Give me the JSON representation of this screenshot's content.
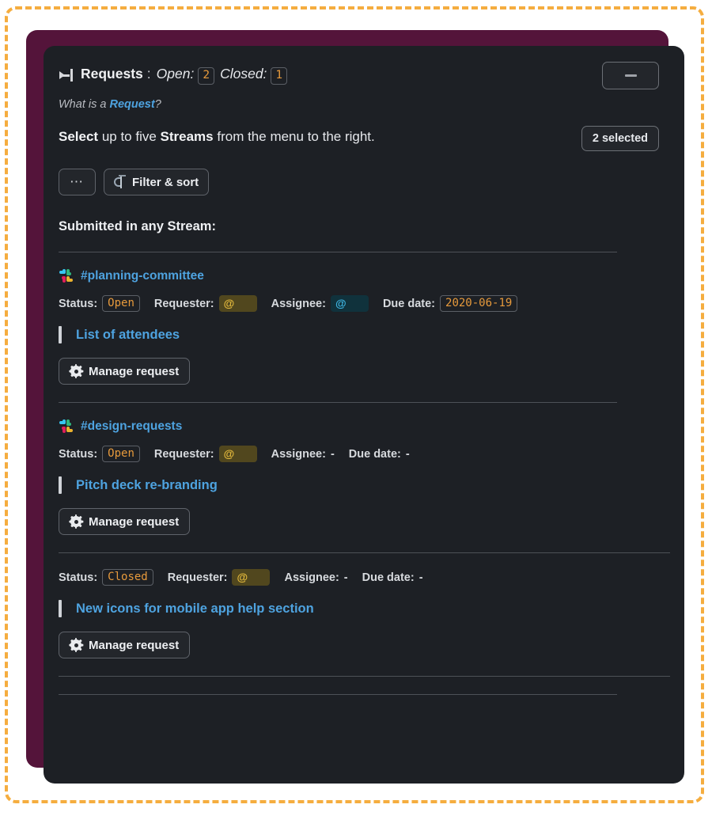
{
  "frame": {
    "dash_color": "#f5ad3f",
    "maroon_color": "#54143a",
    "panel_color": "#1d2025"
  },
  "header": {
    "icon": "collapse-panel-icon",
    "title": "Requests",
    "colon": ":",
    "open_label": "Open:",
    "open_count": "2",
    "closed_label": "Closed:",
    "closed_count": "1",
    "minimize_icon": "minimize-icon"
  },
  "whatis": {
    "prefix": "What is a ",
    "link": "Request",
    "suffix": "?"
  },
  "select_row": {
    "b1": "Select",
    "t1": " up to five ",
    "b2": "Streams",
    "t2": " from the menu to the right.",
    "selected_button": "2 selected"
  },
  "toolbar": {
    "more_label": "⋯",
    "filter_label": "Filter & sort",
    "filter_icon": "filter-sort-icon"
  },
  "section": {
    "heading": "Submitted in any Stream:"
  },
  "requests": [
    {
      "channel": "#planning-committee",
      "channel_icon": "slack-icon",
      "status_label": "Status:",
      "status_value": "Open",
      "requester_label": "Requester:",
      "requester_value": "@",
      "assignee_label": "Assignee:",
      "assignee_value": "@",
      "due_label": "Due date:",
      "due_value": "2020-06-19",
      "title": "List of attendees",
      "manage_label": "Manage request"
    },
    {
      "channel": "#design-requests",
      "channel_icon": "slack-icon",
      "status_label": "Status:",
      "status_value": "Open",
      "requester_label": "Requester:",
      "requester_value": "@",
      "assignee_label": "Assignee:",
      "assignee_value": "-",
      "due_label": "Due date:",
      "due_value": "-",
      "title": "Pitch deck re-branding",
      "manage_label": "Manage request"
    },
    {
      "channel": null,
      "status_label": "Status:",
      "status_value": "Closed",
      "requester_label": "Requester:",
      "requester_value": "@",
      "assignee_label": "Assignee:",
      "assignee_value": "-",
      "due_label": "Due date:",
      "due_value": "-",
      "title": "New icons for mobile app help section",
      "manage_label": "Manage request"
    }
  ]
}
